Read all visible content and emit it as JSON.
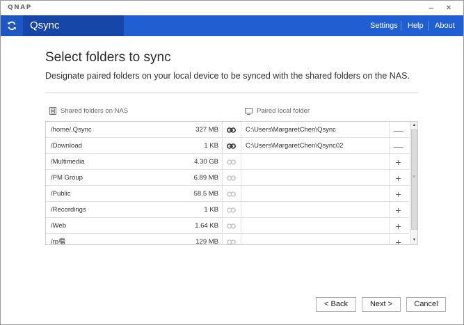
{
  "window": {
    "brand": "QNAP",
    "minimize_glyph": "–",
    "close_glyph": "×"
  },
  "appbar": {
    "app_name": "Qsync",
    "logo_icon": "sync-icon",
    "menu": {
      "settings": "Settings",
      "help": "Help",
      "about": "About"
    }
  },
  "page": {
    "title": "Select folders to sync",
    "description": "Designate paired folders on your local device to be synced with the shared folders on the NAS."
  },
  "columns": {
    "nas": "Shared folders on NAS",
    "local": "Paired local folder"
  },
  "rows": [
    {
      "name": "/home/.Qsync",
      "size": "327 MB",
      "paired": true,
      "local": "C:\\Users\\MargaretChen\\Qsync",
      "action": "—"
    },
    {
      "name": "/Download",
      "size": "1 KB",
      "paired": true,
      "local": "C:\\Users\\MargaretChen\\Qsync02",
      "action": "—"
    },
    {
      "name": "/Multimedia",
      "size": "4.30 GB",
      "paired": false,
      "local": "",
      "action": "+"
    },
    {
      "name": "/PM Group",
      "size": "6.89 MB",
      "paired": false,
      "local": "",
      "action": "+"
    },
    {
      "name": "/Public",
      "size": "58.5 MB",
      "paired": false,
      "local": "",
      "action": "+"
    },
    {
      "name": "/Recordings",
      "size": "1 KB",
      "paired": false,
      "local": "",
      "action": "+"
    },
    {
      "name": "/Web",
      "size": "1.64 KB",
      "paired": false,
      "local": "",
      "action": "+"
    },
    {
      "name": "/rp檔",
      "size": "129 MB",
      "paired": false,
      "local": "",
      "action": "+"
    }
  ],
  "scrollbar": {
    "up": "▲",
    "down": "▼",
    "grip": "≡"
  },
  "buttons": {
    "back": "< Back",
    "next": "Next >",
    "cancel": "Cancel"
  },
  "colors": {
    "header_blue": "#1f5fd2",
    "header_dark": "#1646a8",
    "link_active": "#333333",
    "link_inactive": "#c8c8c8"
  }
}
